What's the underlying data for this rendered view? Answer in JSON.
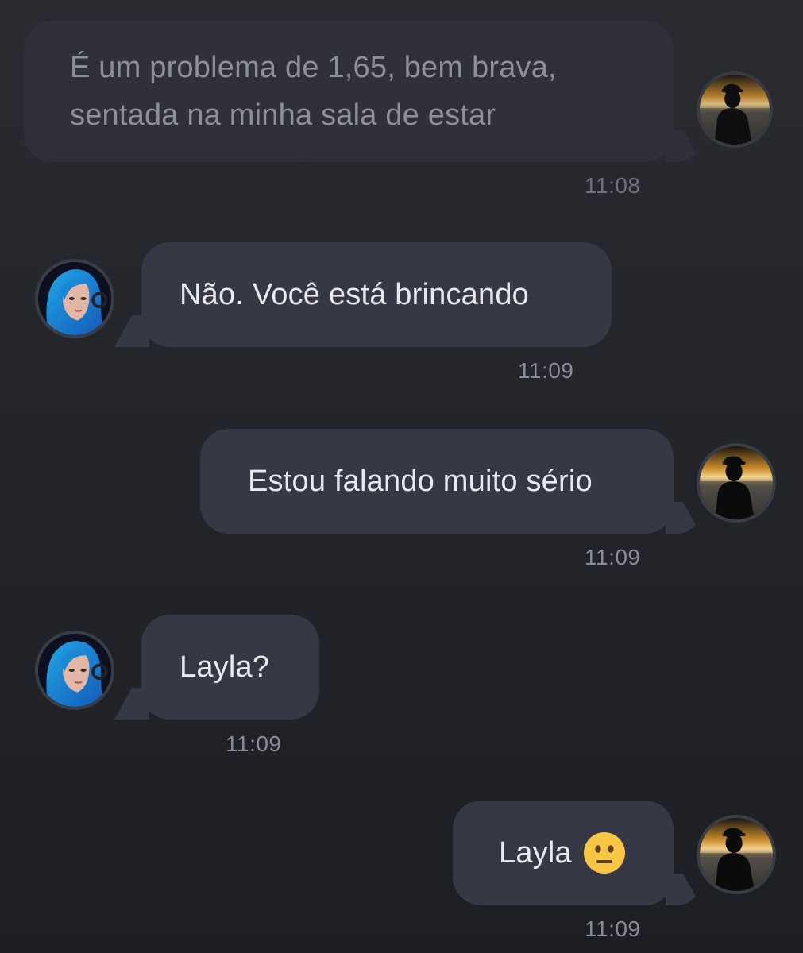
{
  "messages": [
    {
      "sender": "me",
      "text_line1": "É um problema de 1,65, bem brava,",
      "text_line2": "sentada na minha sala de estar",
      "time": "11:08"
    },
    {
      "sender": "Layla",
      "text": "Não. Você está brincando",
      "time": "11:09"
    },
    {
      "sender": "me",
      "text": "Estou falando muito sério",
      "time": "11:09"
    },
    {
      "sender": "Layla",
      "text": "Layla?",
      "time": "11:09"
    },
    {
      "sender": "me",
      "text": "Layla",
      "emoji": "neutral-face-emoji",
      "time": "11:09"
    }
  ],
  "colors": {
    "background": "#23252b",
    "bubble": "#373845",
    "bubble_faded": "#2f3039",
    "text": "#e9e9ee",
    "timestamp": "#8a8b94",
    "emoji_yellow": "#f7c744"
  },
  "icons": {
    "user_avatar": "silhouette-sunset-avatar",
    "contact_avatar": "blue-haired-girl-avatar"
  }
}
